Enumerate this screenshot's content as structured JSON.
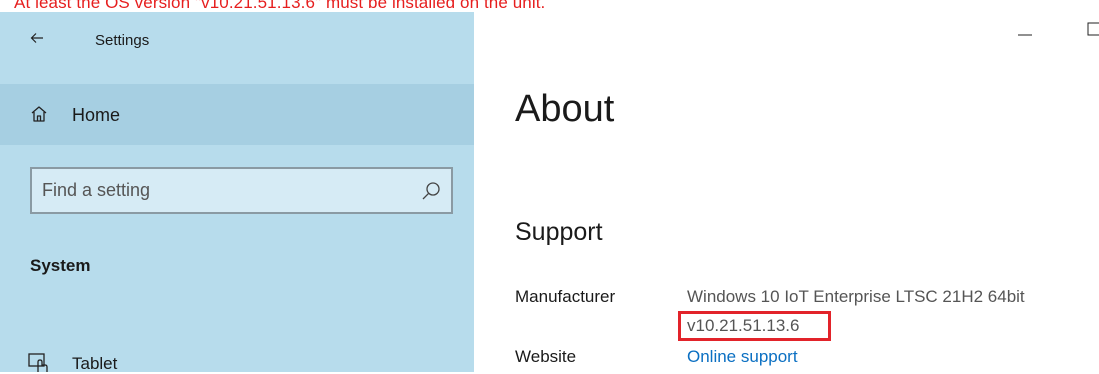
{
  "caption": {
    "text": "At least the OS version \"v10.21.51.13.6\" must be installed on the unit."
  },
  "window": {
    "title": "Settings",
    "back_icon": "back-arrow-icon",
    "minimize_icon": "minimize-icon",
    "maximize_icon": "maximize-icon"
  },
  "sidebar": {
    "home": {
      "label": "Home",
      "icon": "home-icon"
    },
    "search": {
      "placeholder": "Find a setting",
      "value": "",
      "icon": "search-icon"
    },
    "group_heading": "System",
    "items": [
      {
        "label": "Tablet",
        "icon": "tablet-icon"
      }
    ]
  },
  "main": {
    "title": "About",
    "section": "Support",
    "fields": [
      {
        "label": "Manufacturer",
        "value_line1": "Windows 10 IoT Enterprise LTSC 21H2 64bit",
        "value_line2": "v10.21.51.13.6"
      },
      {
        "label": "Website",
        "link": "Online support"
      }
    ]
  },
  "colors": {
    "sidebar_bg": "#b7dcec",
    "home_selected_bg": "#a6cfe2",
    "caption_red": "#e61e1e",
    "highlight_red": "#e2232a",
    "link_blue": "#0a6fc2"
  }
}
